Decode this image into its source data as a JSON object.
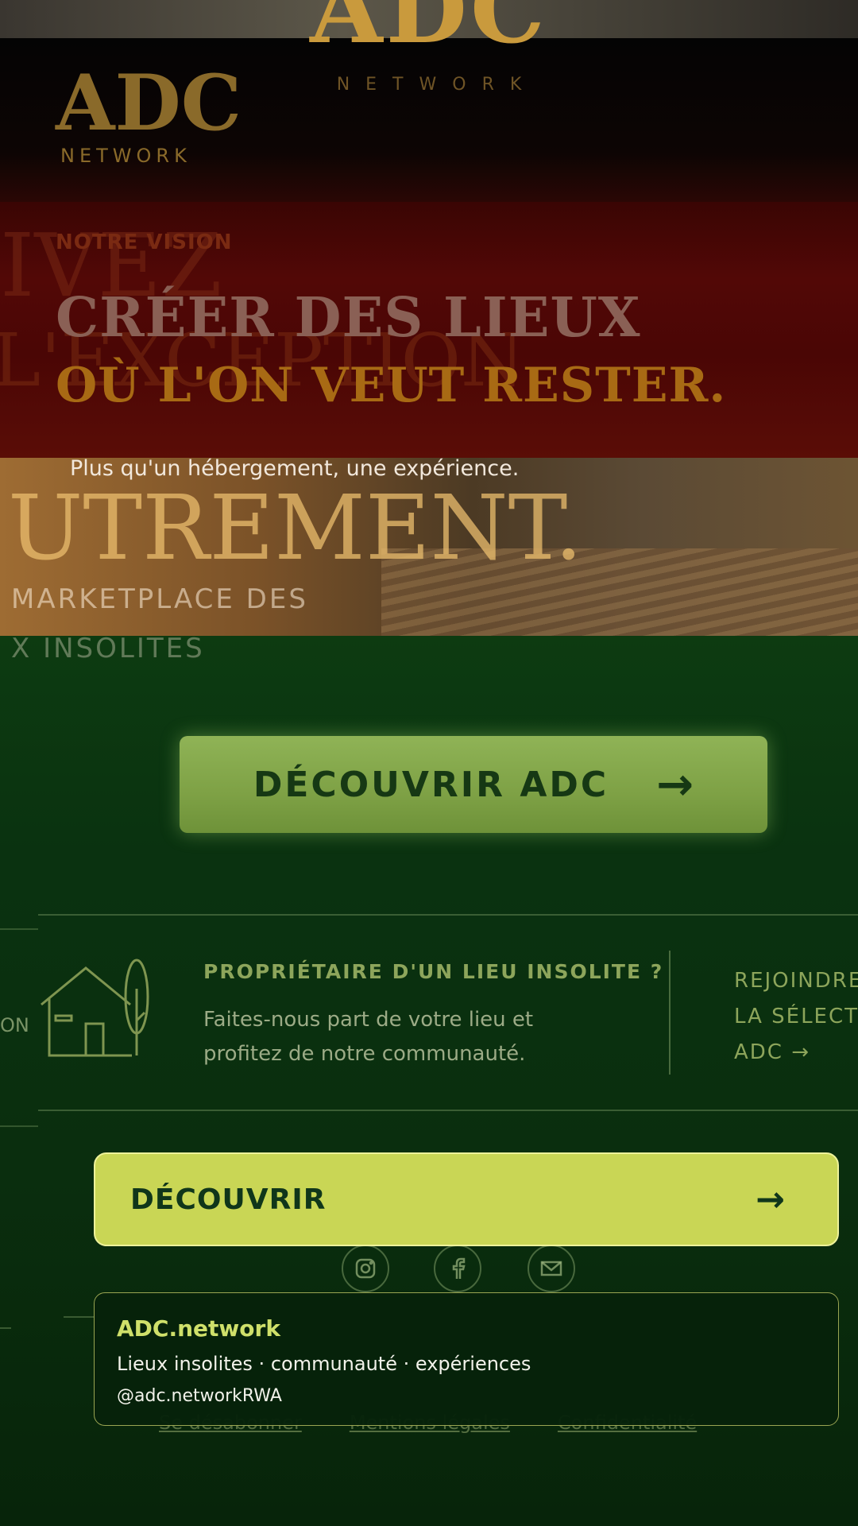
{
  "ghost": {
    "logo": "ADC",
    "network": "NETWORK",
    "headline_1": "IVEZ",
    "headline_2": "L'EXCEPTION",
    "headline_3": "UTREMENT.",
    "market_1": "MARKETPLACE DES",
    "market_2": "X INSOLITES",
    "cta_label": "DÉCOUVRIR ADC",
    "cta_arrow": "→",
    "owner_title": "PROPRIÉTAIRE D'UN LIEU INSOLITE ?",
    "owner_desc": "Faites-nous part de votre lieu et profitez de notre communauté.",
    "join_line_1": "REJOINDRE",
    "join_line_2": "LA SÉLECTI",
    "join_line_3": "ADC →",
    "side_text": "ON",
    "footer_links": [
      "Se désabonner",
      "Mentions légales",
      "Confidentialité"
    ]
  },
  "logo": {
    "name": "ADC",
    "sub": "NETWORK"
  },
  "vision": {
    "label": "NOTRE VISION",
    "headline_1": "CRÉER DES LIEUX",
    "headline_2": "OÙ L'ON VEUT RESTER.",
    "tagline": "Plus qu'un hébergement, une expérience."
  },
  "cta": {
    "label": "DÉCOUVRIR",
    "arrow": "→"
  },
  "card": {
    "title": "ADC.network",
    "description": "Lieux insolites · communauté · expériences",
    "handle": "@adc.networkRWA"
  },
  "social": [
    "instagram-icon",
    "facebook-icon",
    "mail-icon"
  ],
  "colors": {
    "gold": "#8a6a2a",
    "cta_bg": "#c9d655",
    "cta_text": "#10361a",
    "background_green": "#0a2e0e"
  }
}
